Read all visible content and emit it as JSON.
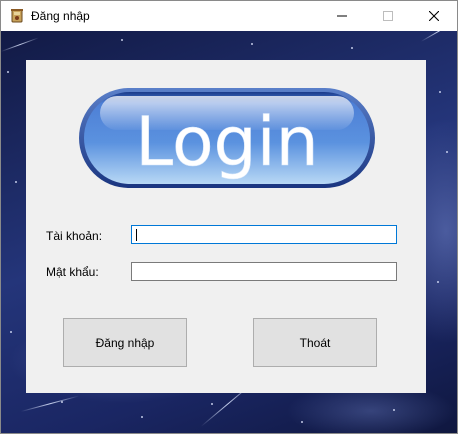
{
  "window": {
    "title": "Đăng nhập",
    "app_icon": "app-icon",
    "controls": [
      "minimize-icon",
      "maximize-icon",
      "close-icon"
    ]
  },
  "logo": {
    "text": "Login",
    "colors": {
      "pill_top": "#a8c6f0",
      "pill_mid": "#3a6fc8",
      "pill_border": "#1e3f8f",
      "text": "#ffffff"
    }
  },
  "form": {
    "username": {
      "label": "Tài khoản:",
      "value": "",
      "focused": true
    },
    "password": {
      "label": "Mật khẩu:",
      "value": ""
    }
  },
  "buttons": {
    "login": "Đăng nhập",
    "exit": "Thoát"
  },
  "colors": {
    "panel": "#f0f0f0",
    "button_face": "#e1e1e1",
    "focus_border": "#0078d7",
    "background": "#1b2a5c"
  }
}
